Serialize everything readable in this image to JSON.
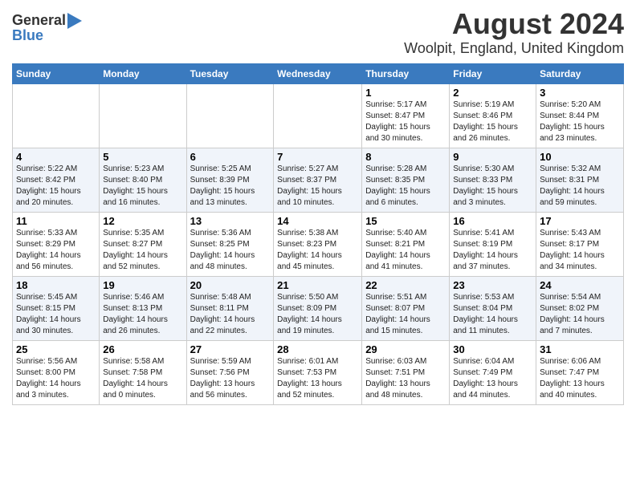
{
  "logo": {
    "general": "General",
    "blue": "Blue"
  },
  "title": "August 2024",
  "subtitle": "Woolpit, England, United Kingdom",
  "days_of_week": [
    "Sunday",
    "Monday",
    "Tuesday",
    "Wednesday",
    "Thursday",
    "Friday",
    "Saturday"
  ],
  "weeks": [
    [
      {
        "day": "",
        "info": ""
      },
      {
        "day": "",
        "info": ""
      },
      {
        "day": "",
        "info": ""
      },
      {
        "day": "",
        "info": ""
      },
      {
        "day": "1",
        "info": "Sunrise: 5:17 AM\nSunset: 8:47 PM\nDaylight: 15 hours\nand 30 minutes."
      },
      {
        "day": "2",
        "info": "Sunrise: 5:19 AM\nSunset: 8:46 PM\nDaylight: 15 hours\nand 26 minutes."
      },
      {
        "day": "3",
        "info": "Sunrise: 5:20 AM\nSunset: 8:44 PM\nDaylight: 15 hours\nand 23 minutes."
      }
    ],
    [
      {
        "day": "4",
        "info": "Sunrise: 5:22 AM\nSunset: 8:42 PM\nDaylight: 15 hours\nand 20 minutes."
      },
      {
        "day": "5",
        "info": "Sunrise: 5:23 AM\nSunset: 8:40 PM\nDaylight: 15 hours\nand 16 minutes."
      },
      {
        "day": "6",
        "info": "Sunrise: 5:25 AM\nSunset: 8:39 PM\nDaylight: 15 hours\nand 13 minutes."
      },
      {
        "day": "7",
        "info": "Sunrise: 5:27 AM\nSunset: 8:37 PM\nDaylight: 15 hours\nand 10 minutes."
      },
      {
        "day": "8",
        "info": "Sunrise: 5:28 AM\nSunset: 8:35 PM\nDaylight: 15 hours\nand 6 minutes."
      },
      {
        "day": "9",
        "info": "Sunrise: 5:30 AM\nSunset: 8:33 PM\nDaylight: 15 hours\nand 3 minutes."
      },
      {
        "day": "10",
        "info": "Sunrise: 5:32 AM\nSunset: 8:31 PM\nDaylight: 14 hours\nand 59 minutes."
      }
    ],
    [
      {
        "day": "11",
        "info": "Sunrise: 5:33 AM\nSunset: 8:29 PM\nDaylight: 14 hours\nand 56 minutes."
      },
      {
        "day": "12",
        "info": "Sunrise: 5:35 AM\nSunset: 8:27 PM\nDaylight: 14 hours\nand 52 minutes."
      },
      {
        "day": "13",
        "info": "Sunrise: 5:36 AM\nSunset: 8:25 PM\nDaylight: 14 hours\nand 48 minutes."
      },
      {
        "day": "14",
        "info": "Sunrise: 5:38 AM\nSunset: 8:23 PM\nDaylight: 14 hours\nand 45 minutes."
      },
      {
        "day": "15",
        "info": "Sunrise: 5:40 AM\nSunset: 8:21 PM\nDaylight: 14 hours\nand 41 minutes."
      },
      {
        "day": "16",
        "info": "Sunrise: 5:41 AM\nSunset: 8:19 PM\nDaylight: 14 hours\nand 37 minutes."
      },
      {
        "day": "17",
        "info": "Sunrise: 5:43 AM\nSunset: 8:17 PM\nDaylight: 14 hours\nand 34 minutes."
      }
    ],
    [
      {
        "day": "18",
        "info": "Sunrise: 5:45 AM\nSunset: 8:15 PM\nDaylight: 14 hours\nand 30 minutes."
      },
      {
        "day": "19",
        "info": "Sunrise: 5:46 AM\nSunset: 8:13 PM\nDaylight: 14 hours\nand 26 minutes."
      },
      {
        "day": "20",
        "info": "Sunrise: 5:48 AM\nSunset: 8:11 PM\nDaylight: 14 hours\nand 22 minutes."
      },
      {
        "day": "21",
        "info": "Sunrise: 5:50 AM\nSunset: 8:09 PM\nDaylight: 14 hours\nand 19 minutes."
      },
      {
        "day": "22",
        "info": "Sunrise: 5:51 AM\nSunset: 8:07 PM\nDaylight: 14 hours\nand 15 minutes."
      },
      {
        "day": "23",
        "info": "Sunrise: 5:53 AM\nSunset: 8:04 PM\nDaylight: 14 hours\nand 11 minutes."
      },
      {
        "day": "24",
        "info": "Sunrise: 5:54 AM\nSunset: 8:02 PM\nDaylight: 14 hours\nand 7 minutes."
      }
    ],
    [
      {
        "day": "25",
        "info": "Sunrise: 5:56 AM\nSunset: 8:00 PM\nDaylight: 14 hours\nand 3 minutes."
      },
      {
        "day": "26",
        "info": "Sunrise: 5:58 AM\nSunset: 7:58 PM\nDaylight: 14 hours\nand 0 minutes."
      },
      {
        "day": "27",
        "info": "Sunrise: 5:59 AM\nSunset: 7:56 PM\nDaylight: 13 hours\nand 56 minutes."
      },
      {
        "day": "28",
        "info": "Sunrise: 6:01 AM\nSunset: 7:53 PM\nDaylight: 13 hours\nand 52 minutes."
      },
      {
        "day": "29",
        "info": "Sunrise: 6:03 AM\nSunset: 7:51 PM\nDaylight: 13 hours\nand 48 minutes."
      },
      {
        "day": "30",
        "info": "Sunrise: 6:04 AM\nSunset: 7:49 PM\nDaylight: 13 hours\nand 44 minutes."
      },
      {
        "day": "31",
        "info": "Sunrise: 6:06 AM\nSunset: 7:47 PM\nDaylight: 13 hours\nand 40 minutes."
      }
    ]
  ]
}
